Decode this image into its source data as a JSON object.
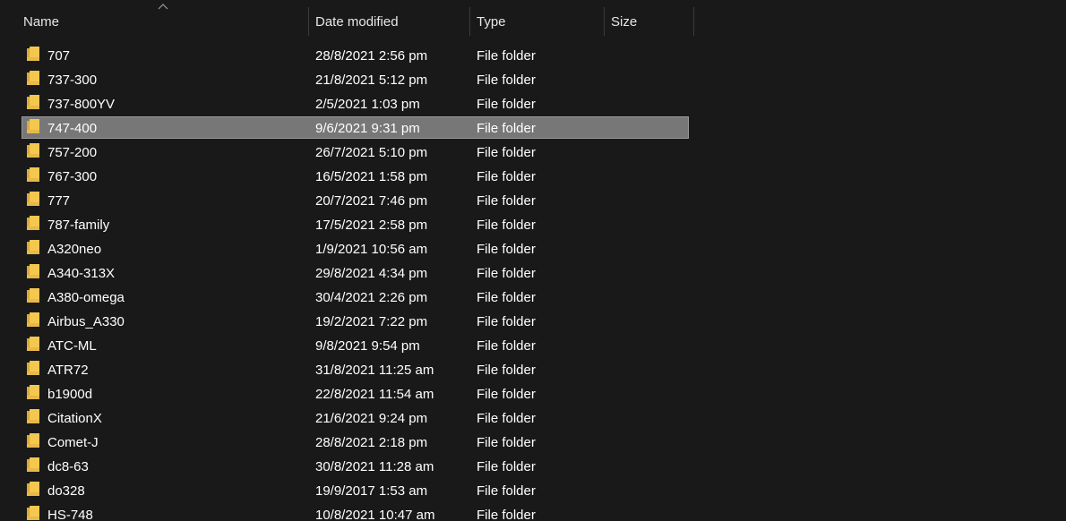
{
  "columns": {
    "name": "Name",
    "date_modified": "Date modified",
    "type": "Type",
    "size": "Size"
  },
  "sort": {
    "column": "name",
    "direction": "ascending",
    "icon": "chevron-up-icon"
  },
  "colors": {
    "background": "#191919",
    "folder": "#f4c74f",
    "selected": "#777777"
  },
  "selected_index": 3,
  "files": [
    {
      "name": "707",
      "date": "28/8/2021 2:56 pm",
      "type": "File folder",
      "size": ""
    },
    {
      "name": "737-300",
      "date": "21/8/2021 5:12 pm",
      "type": "File folder",
      "size": ""
    },
    {
      "name": "737-800YV",
      "date": "2/5/2021 1:03 pm",
      "type": "File folder",
      "size": ""
    },
    {
      "name": "747-400",
      "date": "9/6/2021 9:31 pm",
      "type": "File folder",
      "size": ""
    },
    {
      "name": "757-200",
      "date": "26/7/2021 5:10 pm",
      "type": "File folder",
      "size": ""
    },
    {
      "name": "767-300",
      "date": "16/5/2021 1:58 pm",
      "type": "File folder",
      "size": ""
    },
    {
      "name": "777",
      "date": "20/7/2021 7:46 pm",
      "type": "File folder",
      "size": ""
    },
    {
      "name": "787-family",
      "date": "17/5/2021 2:58 pm",
      "type": "File folder",
      "size": ""
    },
    {
      "name": "A320neo",
      "date": "1/9/2021 10:56 am",
      "type": "File folder",
      "size": ""
    },
    {
      "name": "A340-313X",
      "date": "29/8/2021 4:34 pm",
      "type": "File folder",
      "size": ""
    },
    {
      "name": "A380-omega",
      "date": "30/4/2021 2:26 pm",
      "type": "File folder",
      "size": ""
    },
    {
      "name": "Airbus_A330",
      "date": "19/2/2021 7:22 pm",
      "type": "File folder",
      "size": ""
    },
    {
      "name": "ATC-ML",
      "date": "9/8/2021 9:54 pm",
      "type": "File folder",
      "size": ""
    },
    {
      "name": "ATR72",
      "date": "31/8/2021 11:25 am",
      "type": "File folder",
      "size": ""
    },
    {
      "name": "b1900d",
      "date": "22/8/2021 11:54 am",
      "type": "File folder",
      "size": ""
    },
    {
      "name": "CitationX",
      "date": "21/6/2021 9:24 pm",
      "type": "File folder",
      "size": ""
    },
    {
      "name": "Comet-J",
      "date": "28/8/2021 2:18 pm",
      "type": "File folder",
      "size": ""
    },
    {
      "name": "dc8-63",
      "date": "30/8/2021 11:28 am",
      "type": "File folder",
      "size": ""
    },
    {
      "name": "do328",
      "date": "19/9/2017 1:53 am",
      "type": "File folder",
      "size": ""
    },
    {
      "name": "HS-748",
      "date": "10/8/2021 10:47 am",
      "type": "File folder",
      "size": ""
    }
  ]
}
